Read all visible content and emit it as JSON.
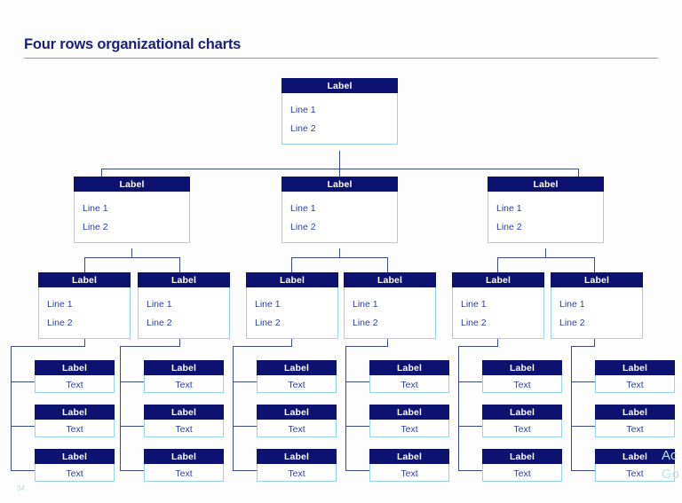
{
  "slide": {
    "title": "Four rows organizational charts",
    "page_number": "34",
    "watermark_line1": "Ac",
    "watermark_line2": "Go",
    "colors": {
      "header_fill": "#0d1270",
      "header_text": "#ffffff",
      "body_border": "#9ad4ea",
      "body_text": "#2a3ea8",
      "connector": "#3c4a86",
      "title_text": "#1b1f7a",
      "title_rule": "#6f9fd8",
      "background": "#fdfdfd"
    }
  },
  "chart_data": {
    "type": "diagram",
    "title": "Four rows organizational charts",
    "levels": 4,
    "level_counts": [
      1,
      3,
      6,
      18
    ]
  },
  "row1": {
    "nodes": [
      {
        "label": "Label",
        "line1": "Line 1",
        "line2": "Line 2"
      }
    ]
  },
  "row2": {
    "nodes": [
      {
        "label": "Label",
        "line1": "Line 1",
        "line2": "Line 2"
      },
      {
        "label": "Label",
        "line1": "Line 1",
        "line2": "Line 2"
      },
      {
        "label": "Label",
        "line1": "Line 1",
        "line2": "Line 2"
      }
    ]
  },
  "row3": {
    "nodes": [
      {
        "label": "Label",
        "line1": "Line 1",
        "line2": "Line 2"
      },
      {
        "label": "Label",
        "line1": "Line 1",
        "line2": "Line 2"
      },
      {
        "label": "Label",
        "line1": "Line 1",
        "line2": "Line 2"
      },
      {
        "label": "Label",
        "line1": "Line 1",
        "line2": "Line 2"
      },
      {
        "label": "Label",
        "line1": "Line 1",
        "line2": "Line 2"
      },
      {
        "label": "Label",
        "line1": "Line 1",
        "line2": "Line 2"
      }
    ]
  },
  "row4": {
    "columns": [
      {
        "nodes": [
          {
            "label": "Label",
            "text": "Text"
          },
          {
            "label": "Label",
            "text": "Text"
          },
          {
            "label": "Label",
            "text": "Text"
          }
        ]
      },
      {
        "nodes": [
          {
            "label": "Label",
            "text": "Text"
          },
          {
            "label": "Label",
            "text": "Text"
          },
          {
            "label": "Label",
            "text": "Text"
          }
        ]
      },
      {
        "nodes": [
          {
            "label": "Label",
            "text": "Text"
          },
          {
            "label": "Label",
            "text": "Text"
          },
          {
            "label": "Label",
            "text": "Text"
          }
        ]
      },
      {
        "nodes": [
          {
            "label": "Label",
            "text": "Text"
          },
          {
            "label": "Label",
            "text": "Text"
          },
          {
            "label": "Label",
            "text": "Text"
          }
        ]
      },
      {
        "nodes": [
          {
            "label": "Label",
            "text": "Text"
          },
          {
            "label": "Label",
            "text": "Text"
          },
          {
            "label": "Label",
            "text": "Text"
          }
        ]
      },
      {
        "nodes": [
          {
            "label": "Label",
            "text": "Text"
          },
          {
            "label": "Label",
            "text": "Text"
          },
          {
            "label": "Label",
            "text": "Text"
          }
        ]
      }
    ]
  }
}
